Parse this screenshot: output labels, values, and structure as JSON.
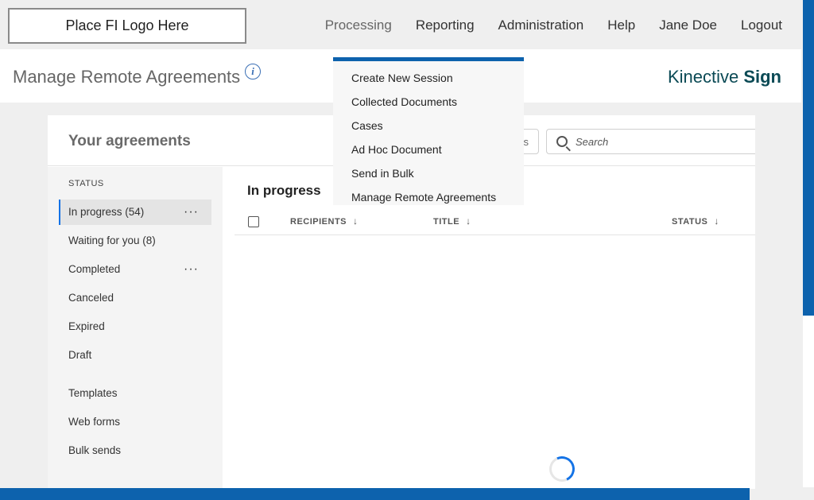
{
  "header": {
    "logo_text": "Place FI Logo Here",
    "nav": [
      "Processing",
      "Reporting",
      "Administration",
      "Help",
      "Jane Doe",
      "Logout"
    ]
  },
  "titlebar": {
    "title": "Manage Remote Agreements",
    "info_icon": "i",
    "brand_light": "Kinective ",
    "brand_bold": "Sign"
  },
  "dropdown": {
    "items": [
      "Create New Session",
      "Collected Documents",
      "Cases",
      "Ad Hoc Document",
      "Send in Bulk",
      "Manage Remote Agreements"
    ]
  },
  "card": {
    "title": "Your agreements",
    "filter_partial": "s",
    "search_placeholder": "Search"
  },
  "sidebar": {
    "status_label": "STATUS",
    "items": [
      {
        "label": "In progress (54)",
        "dots": "···"
      },
      {
        "label": "Waiting for you (8)"
      },
      {
        "label": "Completed",
        "dots": "···"
      },
      {
        "label": "Canceled"
      },
      {
        "label": "Expired"
      },
      {
        "label": "Draft"
      },
      {
        "label": "Templates"
      },
      {
        "label": "Web forms"
      },
      {
        "label": "Bulk sends"
      }
    ]
  },
  "main": {
    "section_title": "In progress",
    "columns": [
      "RECIPIENTS",
      "TITLE",
      "STATUS"
    ],
    "sort_arrow": "↓"
  },
  "colors": {
    "accent": "#0d62ad",
    "brand": "#0b4a55",
    "selection": "#1473e6"
  }
}
